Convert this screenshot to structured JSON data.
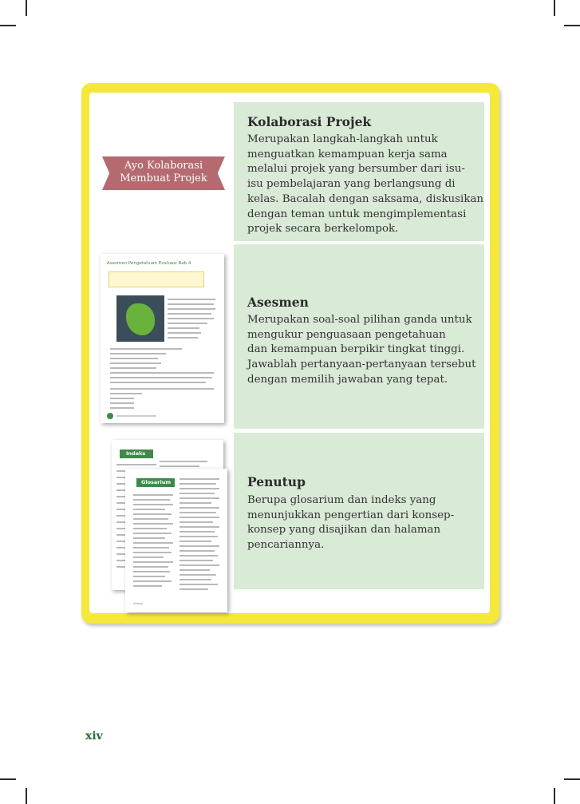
{
  "page_number": "xiv",
  "label_banner": {
    "line1": "Ayo Kolaborasi",
    "line2": "Membuat Projek"
  },
  "sections": [
    {
      "title": "Kolaborasi Projek",
      "lines": [
        "Merupakan langkah-langkah untuk",
        "menguatkan kemampuan  kerja sama",
        "melalui projek yang bersumber dari isu-",
        "isu pembelajaran yang berlangsung di",
        "kelas. Bacalah dengan saksama, diskusikan",
        "dengan teman untuk mengimplementasi",
        "projek secara berkelompok."
      ]
    },
    {
      "title": "Asesmen",
      "lines": [
        "Merupakan soal-soal pilihan ganda untuk",
        "mengukur penguasaan pengetahuan",
        "dan kemampuan berpikir tingkat tinggi.",
        "Jawablah pertanyaan-pertanyaan tersebut",
        "dengan memilih jawaban yang tepat."
      ]
    },
    {
      "title": "Penutup",
      "lines": [
        "Berupa glosarium dan indeks yang",
        "menunjukkan pengertian dari konsep-",
        "konsep yang disajikan dan halaman",
        "pencariannya."
      ]
    }
  ],
  "thumb_asesmen": {
    "title": "Asesmen Pengetahuan Evaluasi Bab 4"
  },
  "thumb_indeks": {
    "title": "Indeks"
  },
  "thumb_glosarium": {
    "title": "Glosarium"
  },
  "colors": {
    "frame": "#f6e83a",
    "panel": "#d9ead6",
    "banner": "#b46a6f",
    "accent_green": "#3f8a4a"
  }
}
